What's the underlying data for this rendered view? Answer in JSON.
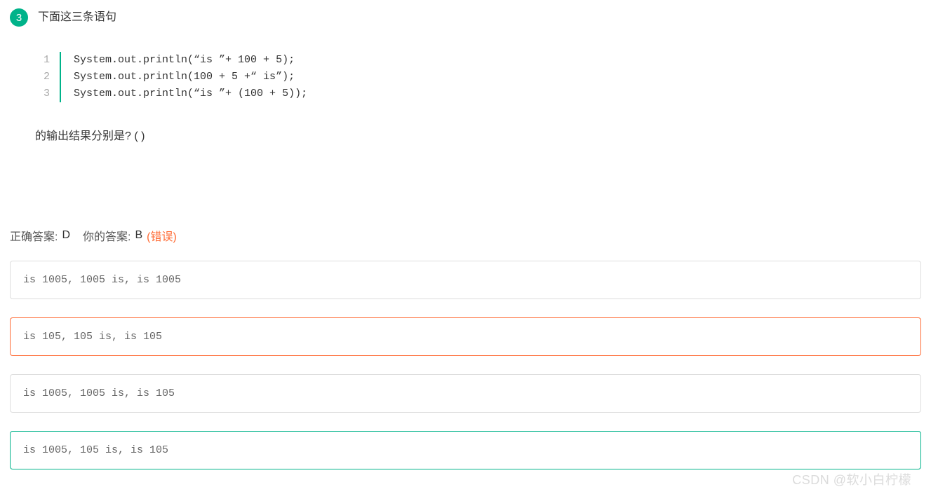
{
  "question": {
    "number": "3",
    "title": "下面这三条语句",
    "code_lines": [
      "System.out.println(“is ”+ 100 + 5);",
      "System.out.println(100 + 5 +“ is”);",
      "System.out.println(“is ”+ (100 + 5));"
    ],
    "line_numbers": [
      "1",
      "2",
      "3"
    ],
    "suffix": "的输出结果分别是? ( )"
  },
  "answer": {
    "correct_label": "正确答案:",
    "correct_value": "D",
    "your_label": "你的答案:",
    "your_value": "B",
    "status": "(错误)"
  },
  "options": [
    {
      "text": "is 1005, 1005 is, is 1005",
      "state": "normal"
    },
    {
      "text": "is 105, 105 is, is 105",
      "state": "selected"
    },
    {
      "text": "is 1005, 1005 is, is 105",
      "state": "normal"
    },
    {
      "text": "is 1005, 105 is, is 105",
      "state": "correct"
    }
  ],
  "watermark": "CSDN @软小白柠檬"
}
